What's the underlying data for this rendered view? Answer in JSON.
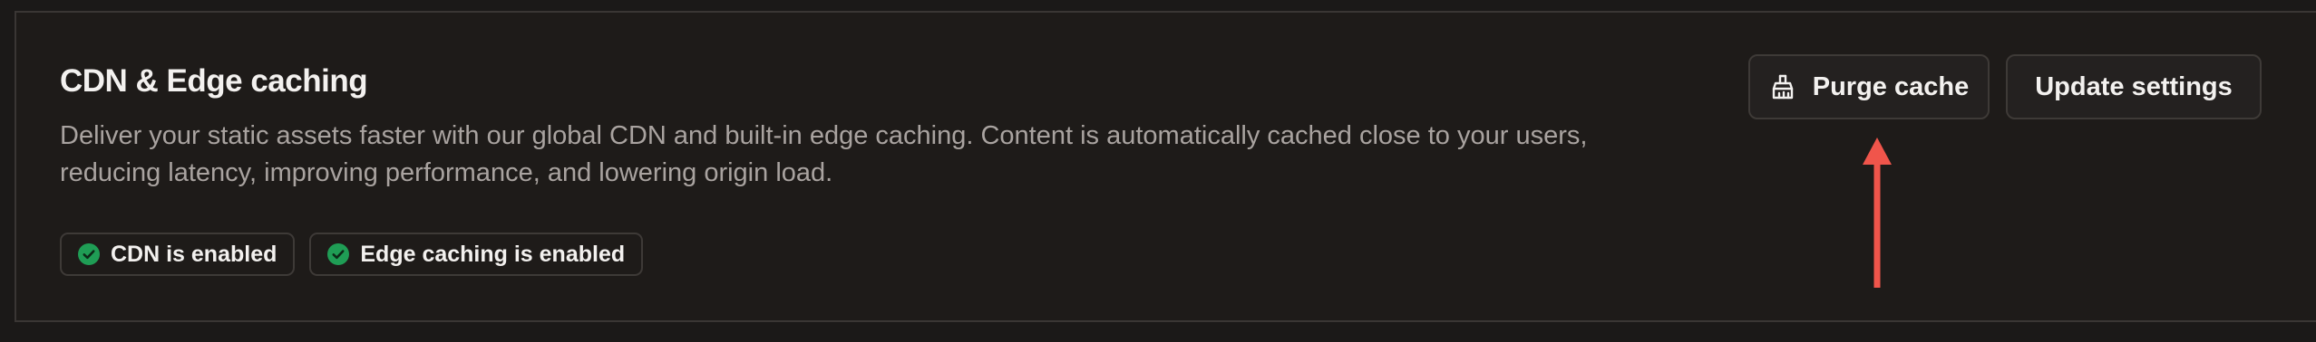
{
  "section": {
    "title": "CDN & Edge caching",
    "description": "Deliver your static assets faster with our global CDN and built-in edge caching. Content is automatically cached close to your users, reducing latency, improving performance, and lowering origin load.",
    "badges": [
      {
        "label": "CDN is enabled",
        "icon": "check-circle-icon"
      },
      {
        "label": "Edge caching is enabled",
        "icon": "check-circle-icon"
      }
    ]
  },
  "actions": {
    "purge_label": "Purge cache",
    "purge_icon": "broom-icon",
    "update_label": "Update settings"
  },
  "annotation": {
    "arrow_color": "#f0554b",
    "arrow_target": "purge-cache-button"
  },
  "colors": {
    "background": "#1e1b19",
    "status_green": "#1f9d55",
    "text_primary": "#f3f1ef",
    "text_secondary": "#a9a3a0"
  }
}
